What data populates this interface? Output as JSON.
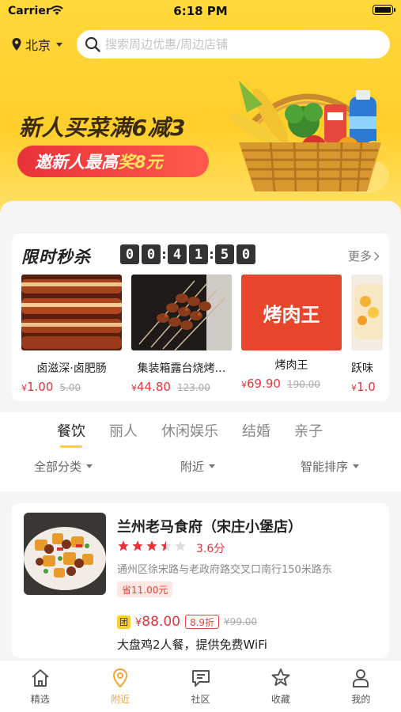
{
  "status": {
    "carrier": "Carrier",
    "time": "6:18 PM"
  },
  "header": {
    "city": "北京",
    "search_placeholder": "搜索周边优惠/周边店铺"
  },
  "banner": {
    "title": "新人买菜满6减3",
    "pill_text": "邀新人最高",
    "pill_highlight": "奖8元"
  },
  "flash_sale": {
    "title": "限时秒杀",
    "countdown": [
      "0",
      "0",
      "4",
      "1",
      "5",
      "0"
    ],
    "more": "更多",
    "items": [
      {
        "name": "卤滋深·卤肥肠",
        "yen": "¥",
        "price": "1.00",
        "old": "5.00"
      },
      {
        "name": "集装箱露台烧烤…",
        "yen": "¥",
        "price": "44.80",
        "old": "123.00"
      },
      {
        "name": "烤肉王",
        "yen": "¥",
        "price": "69.90",
        "old": "190.00",
        "logo_text": "烤肉王"
      },
      {
        "name": "跃味",
        "yen": "¥",
        "price": "1.0",
        "old": ""
      }
    ]
  },
  "categories": {
    "tabs": [
      "餐饮",
      "丽人",
      "休闲娱乐",
      "结婚",
      "亲子"
    ],
    "active": 0
  },
  "filters": {
    "all": "全部分类",
    "nearby": "附近",
    "sort": "智能排序"
  },
  "shop": {
    "name": "兰州老马食府（宋庄小堡店）",
    "rating": 3.6,
    "score": "3.6分",
    "address": "通州区徐宋路与老政府路交叉口南行150米路东",
    "save": "省11.00元",
    "deal_tag": "团",
    "deal_yen": "¥",
    "deal_price": "88.00",
    "deal_discount": "8.9折",
    "deal_old": "¥99.00",
    "deal_desc": "大盘鸡2人餐，提供免费WiFi"
  },
  "tabbar": [
    {
      "label": "精选",
      "icon": "home-icon"
    },
    {
      "label": "附近",
      "icon": "location-icon"
    },
    {
      "label": "社区",
      "icon": "chat-icon"
    },
    {
      "label": "收藏",
      "icon": "star-icon"
    },
    {
      "label": "我的",
      "icon": "user-icon"
    }
  ],
  "colors": {
    "brand_yellow": "#ffcf2b",
    "price_red": "#e8323a",
    "active_tab": "#f4a23a"
  }
}
